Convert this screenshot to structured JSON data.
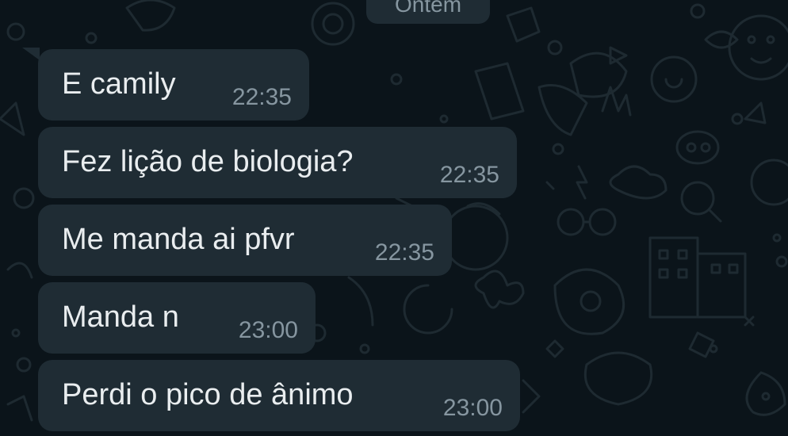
{
  "date_chip": "Ontem",
  "messages": [
    {
      "text": "E camily",
      "time": "22:35"
    },
    {
      "text": "Fez lição de biologia?",
      "time": "22:35"
    },
    {
      "text": "Me manda ai pfvr",
      "time": "22:35"
    },
    {
      "text": "Manda n",
      "time": "23:00"
    },
    {
      "text": "Perdi o pico de ânimo",
      "time": "23:00"
    }
  ]
}
